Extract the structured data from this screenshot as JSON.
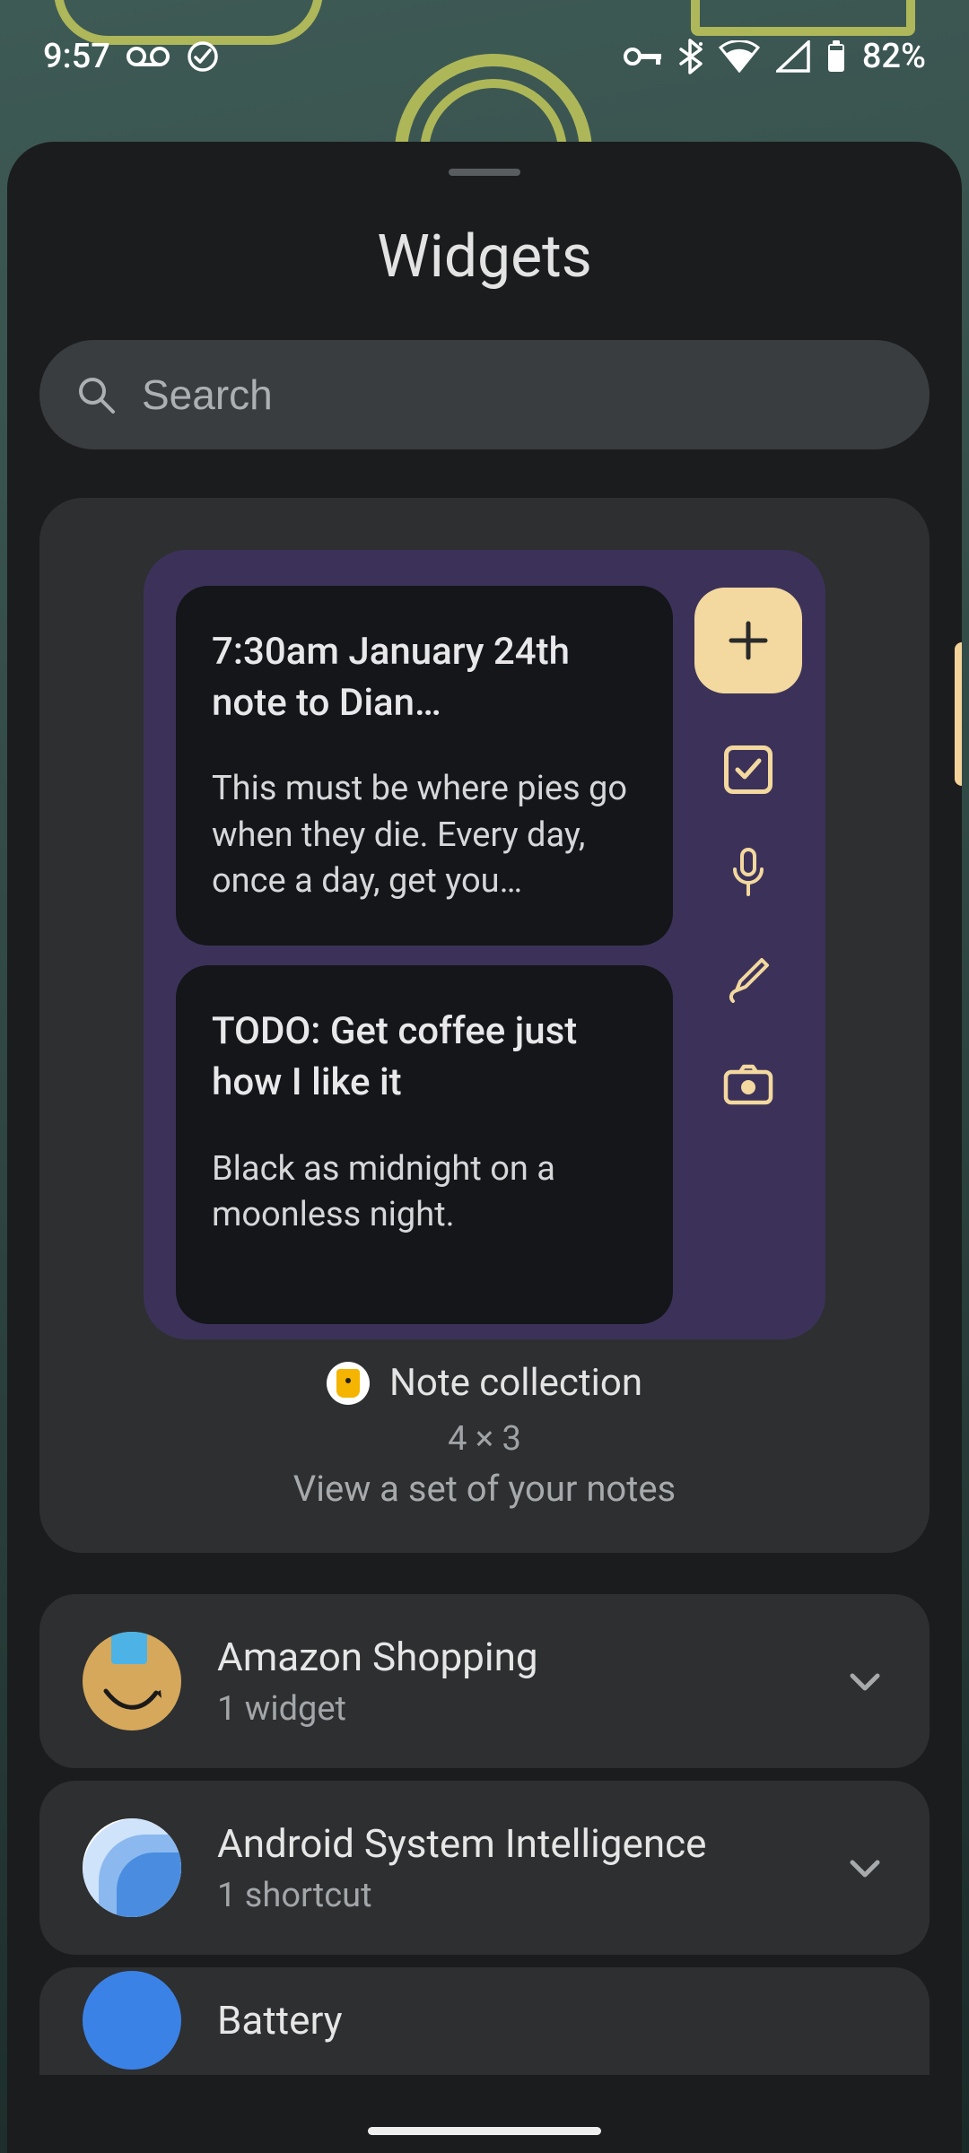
{
  "status": {
    "time": "9:57",
    "battery_pct": "82%"
  },
  "sheet": {
    "title": "Widgets",
    "search_placeholder": "Search"
  },
  "preview": {
    "notes": [
      {
        "title": "7:30am January 24th note to Dian…",
        "body": "This must be where pies go when they die. Every day, once a day, get you…"
      },
      {
        "title": "TODO: Get coffee just how I like it",
        "body": "Black as midnight on a moonless night."
      }
    ],
    "label": "Note collection",
    "size": "4 × 3",
    "description": "View a set of your notes"
  },
  "apps": [
    {
      "name": "Amazon Shopping",
      "subtitle": "1 widget"
    },
    {
      "name": "Android System Intelligence",
      "subtitle": "1 shortcut"
    },
    {
      "name": "Battery",
      "subtitle": ""
    }
  ]
}
